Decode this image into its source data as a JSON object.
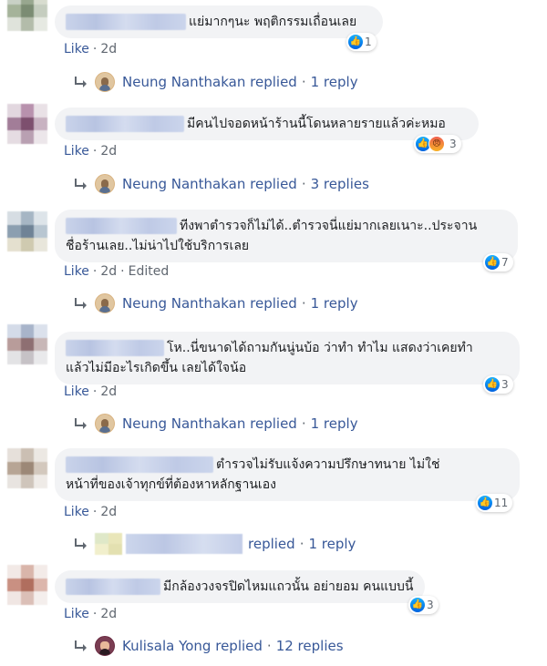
{
  "colors": {
    "link": "#385898",
    "meta": "#606770",
    "bubble": "#f2f3f5",
    "like_blue": "#1877f2"
  },
  "comments": [
    {
      "text": "แย่มากๆนะ พฤติกรรมเถื่อนเลย",
      "lines": [
        "แย่มากๆนะ พฤติกรรมเถื่อนเลย"
      ],
      "reactions": {
        "icons": [
          "like-icon"
        ],
        "count": "1"
      },
      "like": "Like",
      "time": "2d",
      "edited": "",
      "reply": {
        "author": "Neung Nanthakan",
        "verb": "replied",
        "count": "1 reply"
      }
    },
    {
      "text": "มีคนไปจอดหน้าร้านนี้โดนหลายรายแล้วค่ะหมอ",
      "lines": [
        "มีคนไปจอดหน้าร้านนี้โดนหลายรายแล้วค่ะหมอ"
      ],
      "reactions": {
        "icons": [
          "like-icon",
          "angry-icon"
        ],
        "count": "3"
      },
      "like": "Like",
      "time": "2d",
      "edited": "",
      "reply": {
        "author": "Neung Nanthakan",
        "verb": "replied",
        "count": "3 replies"
      }
    },
    {
      "lines": [
        "ทีงพาตำรวจก็ไม่ได้..ตำรวจนี่แย่มากเลยเนาะ..ประจาน",
        "ชื่อร้านเลย..ไม่น่าไปใช้บริการเลย"
      ],
      "reactions": {
        "icons": [
          "like-icon"
        ],
        "count": "7"
      },
      "like": "Like",
      "time": "2d",
      "edited": "Edited",
      "reply": {
        "author": "Neung Nanthakan",
        "verb": "replied",
        "count": "1 reply"
      }
    },
    {
      "lines": [
        "โห..นี่ขนาดได้ถามกันนู่นบ้อ ว่าทำ ทำไม แสดงว่าเคยทำ",
        "แล้วไม่มีอะไรเกิดขึ้น เลยได้ใจน้อ"
      ],
      "reactions": {
        "icons": [
          "like-icon"
        ],
        "count": "3"
      },
      "like": "Like",
      "time": "2d",
      "edited": "",
      "reply": {
        "author": "Neung Nanthakan",
        "verb": "replied",
        "count": "1 reply"
      }
    },
    {
      "lines": [
        "ตำรวจไม่รับแจ้งความปรึกษาทนาย ไม่ใช่",
        "หน้าที่ของเจ้าทุกข์ที่ต้องหาหลักฐานเอง"
      ],
      "reactions": {
        "icons": [
          "like-icon"
        ],
        "count": "11"
      },
      "like": "Like",
      "time": "2d",
      "edited": "",
      "reply": {
        "author": "",
        "verb": "replied",
        "count": "1 reply"
      }
    },
    {
      "lines": [
        "มีกล้องวงจรปิดไหมแถวนั้น อย่ายอม คนแบบนี้"
      ],
      "reactions": {
        "icons": [
          "like-icon"
        ],
        "count": "3"
      },
      "like": "Like",
      "time": "2d",
      "edited": "",
      "reply": {
        "author": "Kulisala Yong",
        "verb": "replied",
        "count": "12 replies"
      }
    }
  ]
}
